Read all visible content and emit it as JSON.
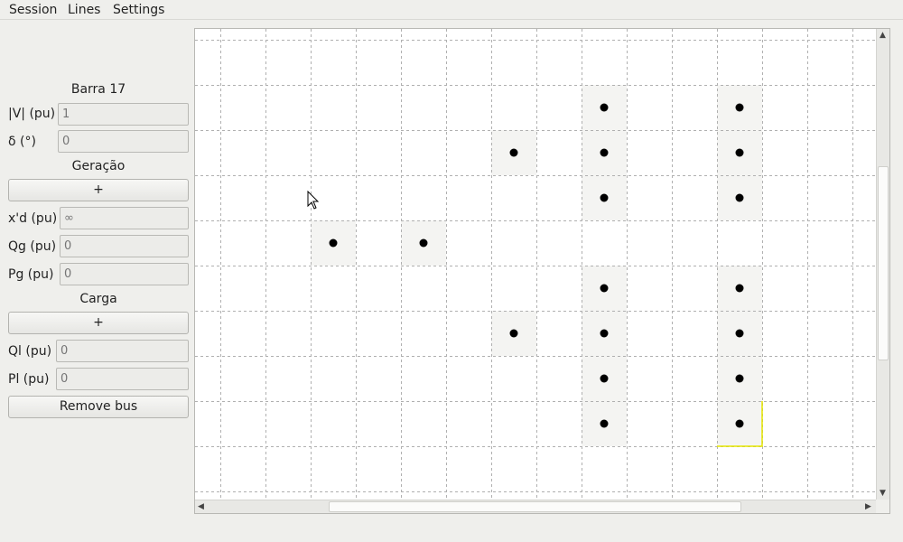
{
  "menubar": {
    "session": "Session",
    "lines": "Lines",
    "settings": "Settings"
  },
  "panel": {
    "bus_title": "Barra 17",
    "v_label": "|V| (pu)",
    "v_value": "1",
    "delta_label": "δ (°)",
    "delta_value": "0",
    "generation_title": "Geração",
    "generation_add": "+",
    "xd_label": "x'd (pu)",
    "xd_value": "∞",
    "qg_label": "Qg (pu)",
    "qg_value": "0",
    "pg_label": "Pg (pu)",
    "pg_value": "0",
    "load_title": "Carga",
    "load_add": "+",
    "ql_label": "Ql (pu)",
    "ql_value": "0",
    "pl_label": "Pl (pu)",
    "pl_value": "0",
    "remove_bus": "Remove bus"
  },
  "canvas": {
    "buses": [
      {
        "col": 8,
        "row": 1
      },
      {
        "col": 11,
        "row": 1
      },
      {
        "col": 6,
        "row": 2
      },
      {
        "col": 8,
        "row": 2
      },
      {
        "col": 11,
        "row": 2
      },
      {
        "col": 8,
        "row": 3
      },
      {
        "col": 11,
        "row": 3
      },
      {
        "col": 2,
        "row": 4
      },
      {
        "col": 4,
        "row": 4
      },
      {
        "col": 8,
        "row": 5
      },
      {
        "col": 11,
        "row": 5
      },
      {
        "col": 6,
        "row": 6
      },
      {
        "col": 8,
        "row": 6
      },
      {
        "col": 11,
        "row": 6
      },
      {
        "col": 8,
        "row": 7
      },
      {
        "col": 11,
        "row": 7
      },
      {
        "col": 8,
        "row": 8
      },
      {
        "col": 11,
        "row": 8
      }
    ],
    "selected_bus": {
      "col": 11,
      "row": 8
    },
    "colors": {
      "bus_highlight": "#f4f4f2",
      "bus_dot": "#000000",
      "grid_line": "#b0b0b0",
      "selection": "#e6e600"
    }
  }
}
